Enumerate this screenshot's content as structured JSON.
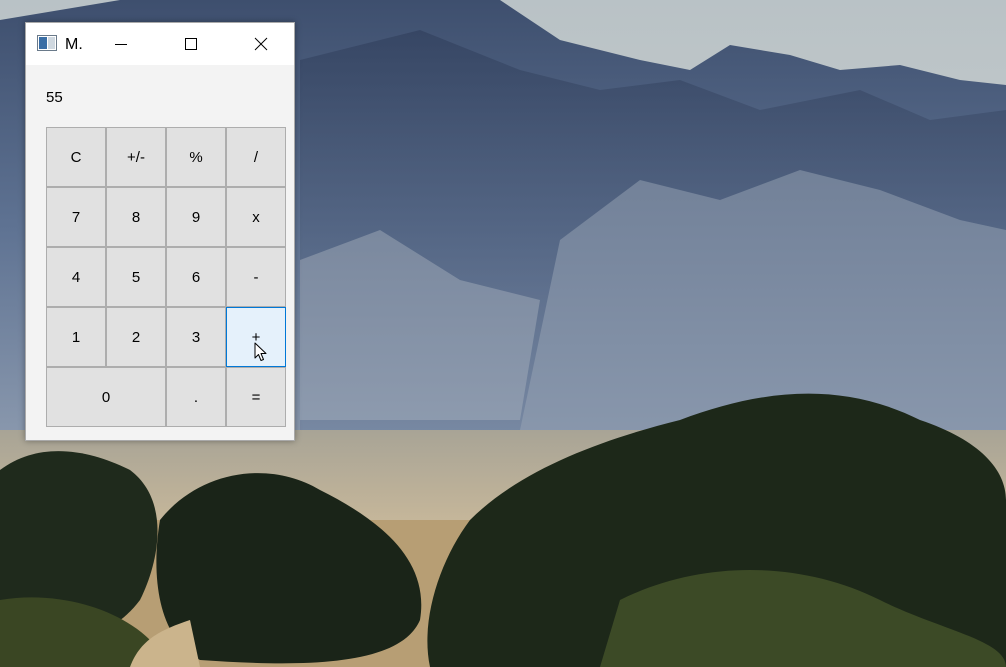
{
  "window": {
    "title": "M.",
    "controls": {
      "minimize": "minimize-icon",
      "maximize": "maximize-icon",
      "close": "close-icon"
    }
  },
  "display": {
    "value": "55"
  },
  "keys": [
    {
      "label": "C",
      "name": "clear-button"
    },
    {
      "label": "+/-",
      "name": "negate-button"
    },
    {
      "label": "%",
      "name": "percent-button"
    },
    {
      "label": "/",
      "name": "divide-button"
    },
    {
      "label": "7",
      "name": "digit-7-button"
    },
    {
      "label": "8",
      "name": "digit-8-button"
    },
    {
      "label": "9",
      "name": "digit-9-button"
    },
    {
      "label": "x",
      "name": "multiply-button"
    },
    {
      "label": "4",
      "name": "digit-4-button"
    },
    {
      "label": "5",
      "name": "digit-5-button"
    },
    {
      "label": "6",
      "name": "digit-6-button"
    },
    {
      "label": "-",
      "name": "subtract-button"
    },
    {
      "label": "1",
      "name": "digit-1-button"
    },
    {
      "label": "2",
      "name": "digit-2-button"
    },
    {
      "label": "3",
      "name": "digit-3-button"
    },
    {
      "label": "+",
      "name": "add-button",
      "hovered": true
    },
    {
      "label": "0",
      "name": "digit-0-button",
      "wide": true
    },
    {
      "label": ".",
      "name": "decimal-button"
    },
    {
      "label": "=",
      "name": "equals-button"
    }
  ],
  "colors": {
    "window_bg": "#f3f3f3",
    "key_bg": "#e1e1e1",
    "key_hover_bg": "#e5f1fb",
    "key_hover_border": "#0078d7"
  }
}
